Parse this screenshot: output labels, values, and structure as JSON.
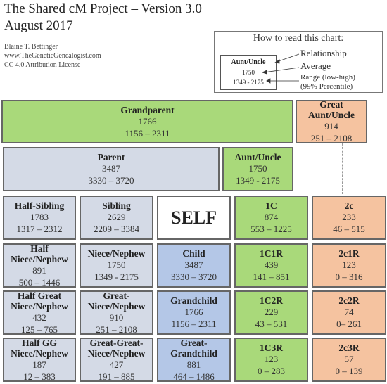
{
  "header": {
    "title": "The Shared cM Project – Version 3.0",
    "date": "August 2017",
    "author": "Blaine T. Bettinger",
    "website": "www.TheGeneticGenealogist.com",
    "license": "CC 4.0 Attribution License"
  },
  "legend": {
    "heading": "How to read this chart:",
    "example": {
      "relationship": "Aunt/Uncle",
      "average": "1750",
      "range": "1349 - 2175"
    },
    "labels": {
      "relationship": "Relationship",
      "average": "Average",
      "range": "Range (low-high)",
      "range_note": "(99% Percentile)"
    }
  },
  "colors": {
    "green": "#a9d97a",
    "orange": "#f5c3a0",
    "grey": "#d4dae6",
    "blue": "#b4c7e7"
  },
  "cells": {
    "grandparent": {
      "name": "Grandparent",
      "avg": "1766",
      "range": "1156 – 2311"
    },
    "great_aunt_uncle": {
      "name": "Great Aunt/Uncle",
      "avg": "914",
      "range": "251 – 2108"
    },
    "parent": {
      "name": "Parent",
      "avg": "3487",
      "range": "3330 – 3720"
    },
    "aunt_uncle": {
      "name": "Aunt/Uncle",
      "avg": "1750",
      "range": "1349 - 2175"
    },
    "half_sibling": {
      "name": "Half-Sibling",
      "avg": "1783",
      "range": "1317 – 2312"
    },
    "sibling": {
      "name": "Sibling",
      "avg": "2629",
      "range": "2209 – 3384"
    },
    "self": {
      "name": "SELF"
    },
    "first_cousin": {
      "name": "1C",
      "avg": "874",
      "range": "553 – 1225"
    },
    "second_cousin": {
      "name": "2c",
      "avg": "233",
      "range": "46 – 515"
    },
    "half_niece_nephew": {
      "name": "Half Niece/Nephew",
      "avg": "891",
      "range": "500 – 1446"
    },
    "niece_nephew": {
      "name": "Niece/Nephew",
      "avg": "1750",
      "range": "1349 - 2175"
    },
    "child": {
      "name": "Child",
      "avg": "3487",
      "range": "3330 – 3720"
    },
    "first_cousin_1r": {
      "name": "1C1R",
      "avg": "439",
      "range": "141 – 851"
    },
    "second_cousin_1r": {
      "name": "2c1R",
      "avg": "123",
      "range": "0 – 316"
    },
    "half_great_niece_nephew": {
      "name": "Half Great Niece/Nephew",
      "avg": "432",
      "range": "125 – 765"
    },
    "great_niece_nephew": {
      "name": "Great-Niece/Nephew",
      "avg": "910",
      "range": "251 – 2108"
    },
    "grandchild": {
      "name": "Grandchild",
      "avg": "1766",
      "range": "1156 – 2311"
    },
    "first_cousin_2r": {
      "name": "1C2R",
      "avg": "229",
      "range": "43 – 531"
    },
    "second_cousin_2r": {
      "name": "2c2R",
      "avg": "74",
      "range": "0– 261"
    },
    "half_gg_niece_nephew": {
      "name": "Half GG Niece/Nephew",
      "avg": "187",
      "range": "12 – 383"
    },
    "great_great_niece_nephew": {
      "name": "Great-Great-Niece/Nephew",
      "avg": "427",
      "range": "191 – 885"
    },
    "great_grandchild": {
      "name": "Great-Grandchild",
      "avg": "881",
      "range": "464 – 1486"
    },
    "first_cousin_3r": {
      "name": "1C3R",
      "avg": "123",
      "range": "0 – 283"
    },
    "second_cousin_3r": {
      "name": "2c3R",
      "avg": "57",
      "range": "0 – 139"
    }
  }
}
